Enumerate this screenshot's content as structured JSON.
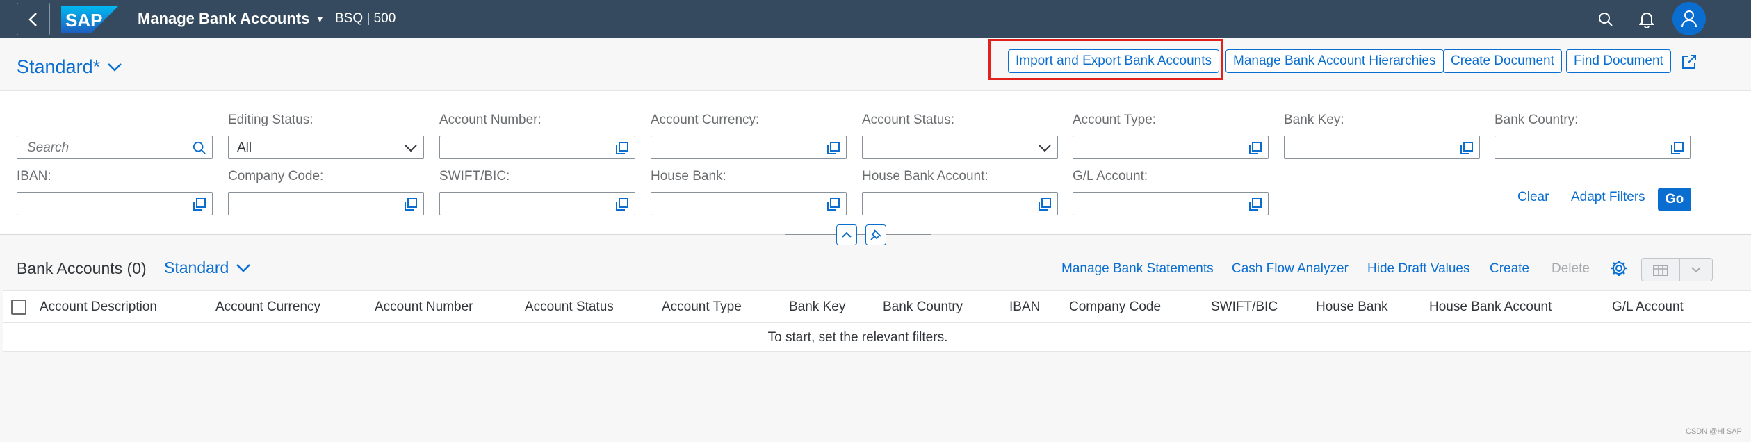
{
  "shell": {
    "logo_text": "SAP",
    "app_title": "Manage Bank Accounts",
    "system_info": "BSQ | 500",
    "icons": [
      "back-icon",
      "search-icon",
      "bell-icon",
      "user-icon"
    ]
  },
  "header": {
    "variant_label": "Standard*",
    "buttons": {
      "import_export": "Import and Export Bank Accounts",
      "hierarchies": "Manage Bank Account Hierarchies",
      "create_document": "Create Document",
      "find_document": "Find Document"
    },
    "highlight_color": "#e0211c"
  },
  "filters": {
    "search_placeholder": "Search",
    "editing_status": {
      "label": "Editing Status:",
      "value": "All"
    },
    "account_number": {
      "label": "Account Number:",
      "value": ""
    },
    "account_currency": {
      "label": "Account Currency:",
      "value": ""
    },
    "account_status": {
      "label": "Account Status:",
      "value": ""
    },
    "account_type": {
      "label": "Account Type:",
      "value": ""
    },
    "bank_key": {
      "label": "Bank Key:",
      "value": ""
    },
    "bank_country": {
      "label": "Bank Country:",
      "value": ""
    },
    "iban": {
      "label": "IBAN:",
      "value": ""
    },
    "company_code": {
      "label": "Company Code:",
      "value": ""
    },
    "swift_bic": {
      "label": "SWIFT/BIC:",
      "value": ""
    },
    "house_bank": {
      "label": "House Bank:",
      "value": ""
    },
    "house_bank_account": {
      "label": "House Bank Account:",
      "value": ""
    },
    "gl_account": {
      "label": "G/L Account:",
      "value": ""
    },
    "actions": {
      "clear": "Clear",
      "adapt": "Adapt Filters",
      "go": "Go"
    }
  },
  "table": {
    "title": "Bank Accounts (0)",
    "variant": "Standard",
    "toolbar": {
      "manage_statements": "Manage Bank Statements",
      "cash_flow": "Cash Flow Analyzer",
      "hide_draft": "Hide Draft Values",
      "create": "Create",
      "delete": "Delete"
    },
    "columns": [
      "Account Description",
      "Account Currency",
      "Account Number",
      "Account Status",
      "Account Type",
      "Bank Key",
      "Bank Country",
      "IBAN",
      "Company Code",
      "SWIFT/BIC",
      "House Bank",
      "House Bank Account",
      "G/L Account"
    ],
    "empty_message": "To start, set the relevant filters."
  },
  "watermark": "CSDN @Hi SAP",
  "colors": {
    "shell": "#354a5f",
    "accent": "#0a6ed1",
    "text": "#32363a"
  }
}
